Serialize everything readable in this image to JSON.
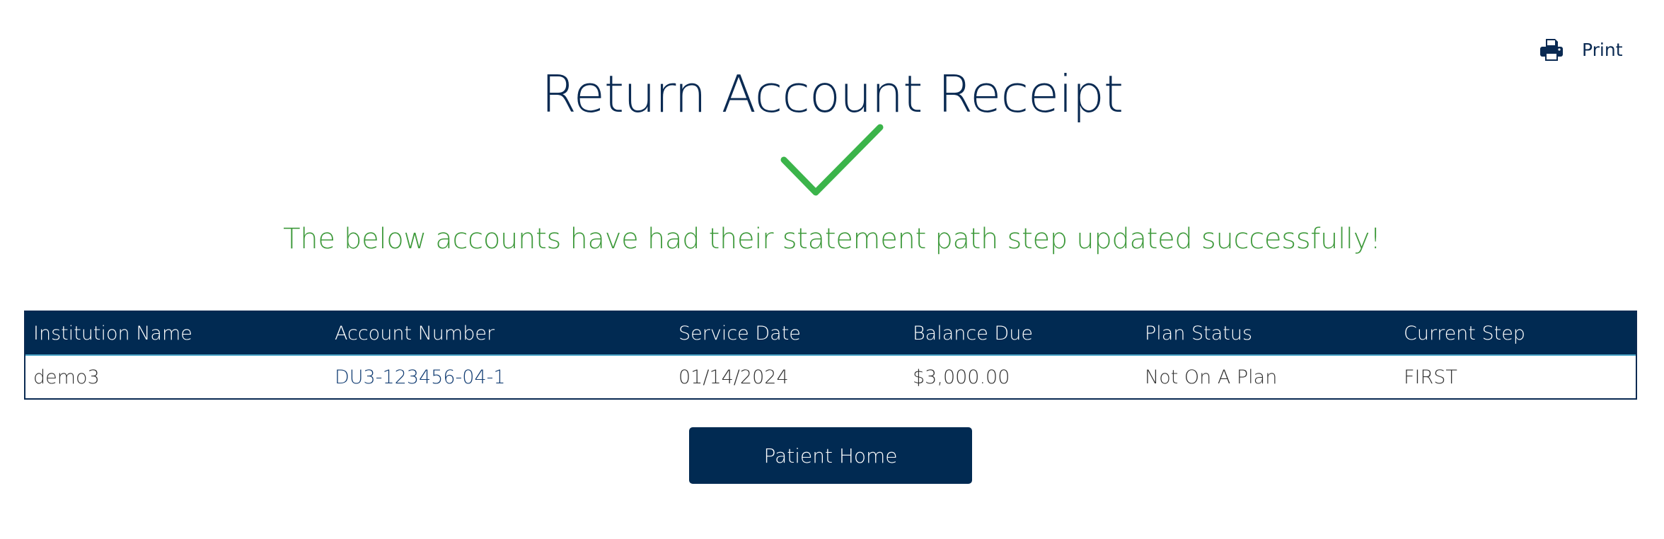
{
  "page": {
    "title": "Return Account Receipt",
    "success_message": "The below accounts have had their statement path step updated successfully!"
  },
  "print": {
    "label": "Print",
    "icon": "printer-icon"
  },
  "status_icon": "checkmark-icon",
  "colors": {
    "primary": "#012a52",
    "success": "#3f9a3c",
    "check": "#3bb44a",
    "link": "#123d73"
  },
  "table": {
    "headers": [
      "Institution Name",
      "Account Number",
      "Service Date",
      "Balance Due",
      "Plan Status",
      "Current Step"
    ],
    "rows": [
      {
        "institution_name": "demo3",
        "account_number": "DU3-123456-04-1",
        "service_date": "01/14/2024",
        "balance_due": "$3,000.00",
        "plan_status": "Not On A Plan",
        "current_step": "FIRST"
      }
    ]
  },
  "actions": {
    "patient_home_label": "Patient Home"
  }
}
